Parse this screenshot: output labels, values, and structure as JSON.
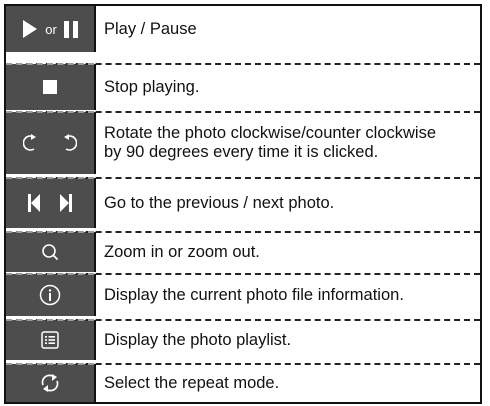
{
  "rows": [
    {
      "icon": "play-pause-icon",
      "or_text": "or",
      "text": "Play / Pause"
    },
    {
      "icon": "stop-icon",
      "text": "Stop playing."
    },
    {
      "icon": "rotate-icon",
      "text_line1": "Rotate the photo clockwise/counter clockwise",
      "text_line2": "by 90 degrees every time it is clicked."
    },
    {
      "icon": "prev-next-icon",
      "text": "Go to the previous / next photo."
    },
    {
      "icon": "zoom-icon",
      "text": "Zoom in or zoom out."
    },
    {
      "icon": "info-icon",
      "text": "Display the current photo file information."
    },
    {
      "icon": "playlist-icon",
      "text": "Display the photo playlist."
    },
    {
      "icon": "repeat-icon",
      "text": "Select the repeat mode."
    }
  ],
  "colors": {
    "icon_cell_bg": "#4d4d4d",
    "border": "#111111",
    "icon_fg": "#ffffff"
  }
}
